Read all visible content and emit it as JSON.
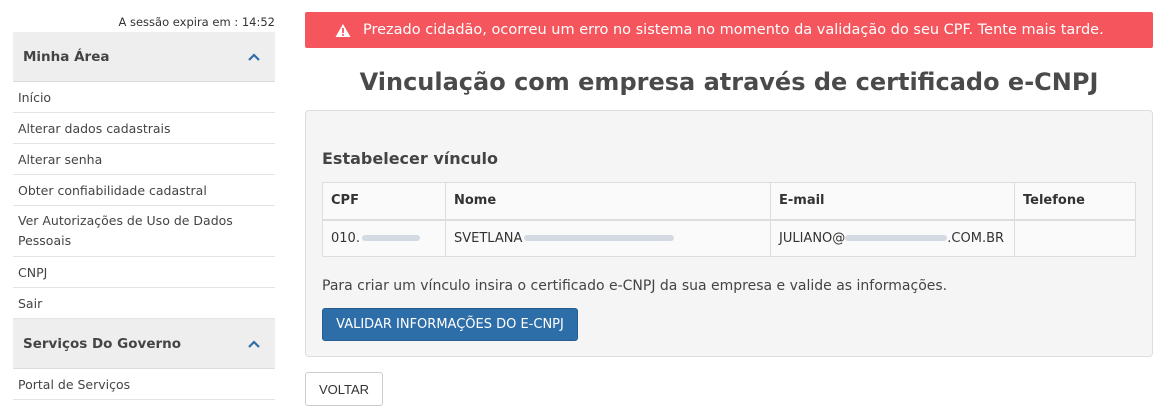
{
  "session": {
    "expires_text": "A sessão expira em : 14:52"
  },
  "sidebar": {
    "sections": [
      {
        "title": "Minha Área",
        "icon": "chevron-up-icon",
        "items": [
          {
            "label": "Início"
          },
          {
            "label": "Alterar dados cadastrais"
          },
          {
            "label": "Alterar senha"
          },
          {
            "label": "Obter confiabilidade cadastral"
          },
          {
            "label": "Ver Autorizações de Uso de Dados Pessoais"
          },
          {
            "label": "CNPJ"
          },
          {
            "label": "Sair"
          }
        ]
      },
      {
        "title": "Serviços Do Governo",
        "icon": "chevron-up-icon",
        "items": [
          {
            "label": "Portal de Serviços"
          }
        ]
      }
    ]
  },
  "alert": {
    "icon": "warning-icon",
    "text": "Prezado cidadão, ocorreu um erro no sistema no momento da validação do seu CPF. Tente mais tarde.",
    "color": "#f5555c"
  },
  "main": {
    "title": "Vinculação com empresa através de certificado e-CNPJ",
    "subtitle": "Estabelecer vínculo",
    "table": {
      "headers": [
        "CPF",
        "Nome",
        "E-mail",
        "Telefone"
      ],
      "row": {
        "cpf": "010.",
        "nome": "SVETLANA",
        "email_prefix": "JULIANO@",
        "email_suffix": ".COM.BR",
        "telefone": ""
      }
    },
    "hint": "Para criar um vínculo insira o certificado e-CNPJ da sua empresa e valide as informações.",
    "validate_button": "VALIDAR INFORMAÇÕES DO E-CNPJ",
    "back_button": "VOLTAR"
  },
  "colors": {
    "primary": "#2e6ea8",
    "chevron": "#2e6ea8",
    "alert": "#f5555c"
  }
}
